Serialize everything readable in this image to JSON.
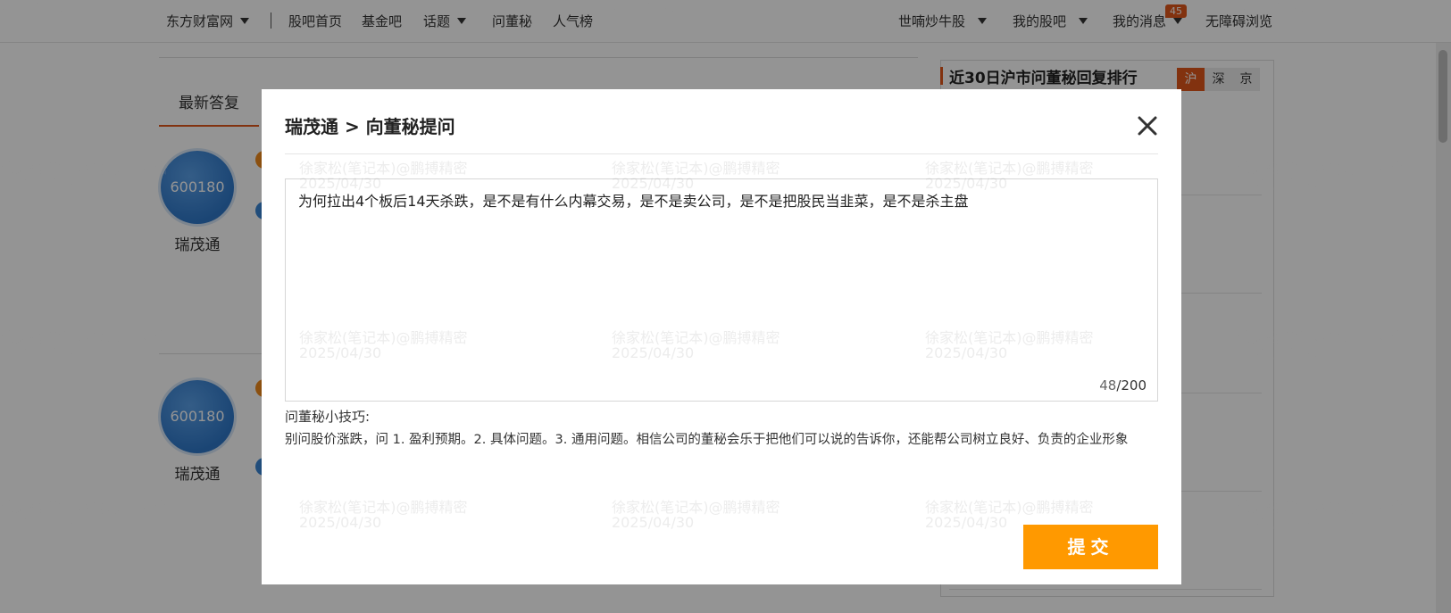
{
  "nav": {
    "brand": "东方财富网",
    "links": [
      "股吧首页",
      "基金吧",
      "话题",
      "问董秘",
      "人气榜"
    ],
    "user_menu": "世喃炒牛股",
    "my_guba": "我的股吧",
    "my_messages": "我的消息",
    "message_count": "45",
    "accessibility": "无障碍浏览"
  },
  "page": {
    "tab_latest": "最新答复",
    "cards": [
      {
        "code": "600180",
        "name": "瑞茂通"
      },
      {
        "code": "600180",
        "name": "瑞茂通"
      }
    ],
    "ranking": {
      "title": "近30日沪市问董秘回复排行",
      "tabs": [
        "沪",
        "深",
        "京"
      ],
      "active_tab": "沪"
    }
  },
  "modal": {
    "title": "瑞茂通 > 向董秘提问",
    "question_text": "为何拉出4个板后14天杀跌，是不是有什么内幕交易，是不是卖公司，是不是把股民当韭菜，是不是杀主盘",
    "char_count": "48",
    "char_limit": "/200",
    "tips_title": "问董秘小技巧:",
    "tips_body": "别问股价涨跌，问 1. 盈利预期。2. 具体问题。3. 通用问题。相信公司的董秘会乐于把他们可以说的告诉你，还能帮公司树立良好、负责的企业形象",
    "submit_label": "提交"
  },
  "watermark": {
    "line1": "徐家松(笔记本)@鹏搏精密",
    "line2": "2025/04/30"
  },
  "colors": {
    "accent": "#e1571a",
    "submit": "#ff9900",
    "avatar": "#2f78c9"
  }
}
